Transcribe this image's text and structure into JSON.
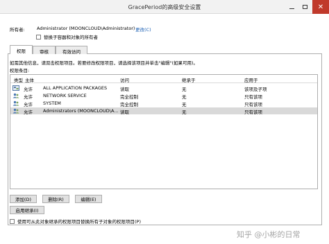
{
  "window": {
    "title": "GracePeriod的高级安全设置",
    "close_glyph": "✕"
  },
  "owner": {
    "label": "所有者:",
    "value": "Administrator (MOONCLOUD\\Administrator)",
    "change_link": "更改(C)",
    "replace_checkbox_label": "替换子容器和对象的所有者",
    "replace_checked": false
  },
  "tabs": [
    {
      "label": "权限",
      "active": true
    },
    {
      "label": "审核",
      "active": false
    },
    {
      "label": "有效访问",
      "active": false
    }
  ],
  "info_text": "如需其他信息，请双击权限项目。若要修改权限项目，请选择该项目并单击\"编辑\"(如果可用)。",
  "permissions": {
    "title": "权限条目:",
    "columns": [
      "类型",
      "主体",
      "访问",
      "继承于",
      "应用于"
    ],
    "rows": [
      {
        "type": "允许",
        "principal": "ALL APPLICATION PACKAGES",
        "access": "读取",
        "inherited": "无",
        "applies_to": "该项及子项",
        "icon": "app-packages-icon",
        "selected": false
      },
      {
        "type": "允许",
        "principal": "NETWORK SERVICE",
        "access": "完全控制",
        "inherited": "无",
        "applies_to": "只有该项",
        "icon": "users-icon",
        "selected": false
      },
      {
        "type": "允许",
        "principal": "SYSTEM",
        "access": "完全控制",
        "inherited": "无",
        "applies_to": "只有该项",
        "icon": "users-icon",
        "selected": false
      },
      {
        "type": "允许",
        "principal": "Administrators (MOONCLOUD\\A...",
        "access": "读取",
        "inherited": "无",
        "applies_to": "只有该项",
        "icon": "users-icon",
        "selected": true
      }
    ]
  },
  "buttons": {
    "add": "添加(D)",
    "remove": "删除(R)",
    "edit": "编辑(E)",
    "enable_inheritance": "启用继承(I)"
  },
  "replace_child": {
    "label": "使用可从此对象继承的权限项目替换所有子对象的权限项目(P)",
    "checked": false
  },
  "watermark": "知乎 @小彬的日常"
}
